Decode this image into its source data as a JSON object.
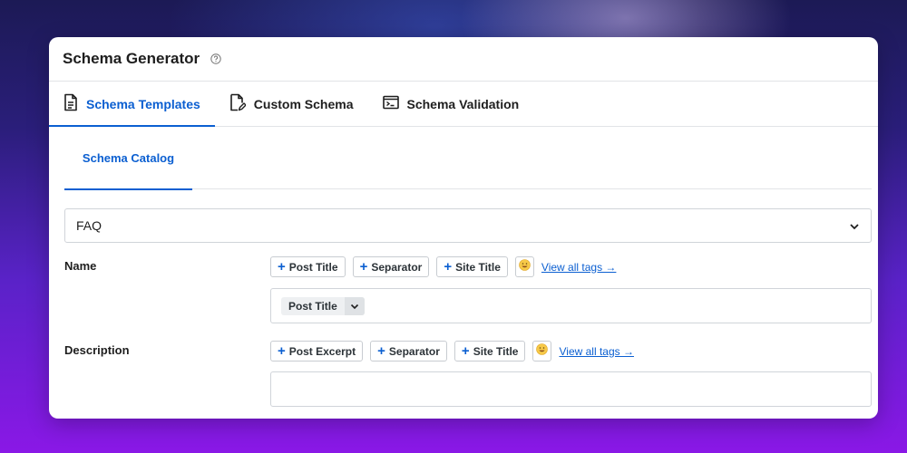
{
  "app": {
    "title": "Schema Generator",
    "help_icon": "help-circle-icon"
  },
  "tabs": [
    {
      "label": "Schema Templates",
      "icon": "document-icon",
      "active": true
    },
    {
      "label": "Custom Schema",
      "icon": "edit-document-icon",
      "active": false
    },
    {
      "label": "Schema Validation",
      "icon": "terminal-icon",
      "active": false
    }
  ],
  "subtabs": [
    {
      "label": "Schema Catalog",
      "active": true
    }
  ],
  "schema_select": {
    "value": "FAQ",
    "icon": "chevron-down-icon"
  },
  "name_row": {
    "label": "Name",
    "tags": [
      "Post Title",
      "Separator",
      "Site Title"
    ],
    "emoji_icon": "smiley-icon",
    "view_all": "View all tags →",
    "field_chip": "Post Title"
  },
  "description_row": {
    "label": "Description",
    "tags": [
      "Post Excerpt",
      "Separator",
      "Site Title"
    ],
    "emoji_icon": "smiley-icon",
    "view_all": "View all tags →",
    "field_value": ""
  },
  "colors": {
    "accent": "#0b5fd1",
    "text": "#1e1e1e",
    "border": "#d0d4d9"
  }
}
